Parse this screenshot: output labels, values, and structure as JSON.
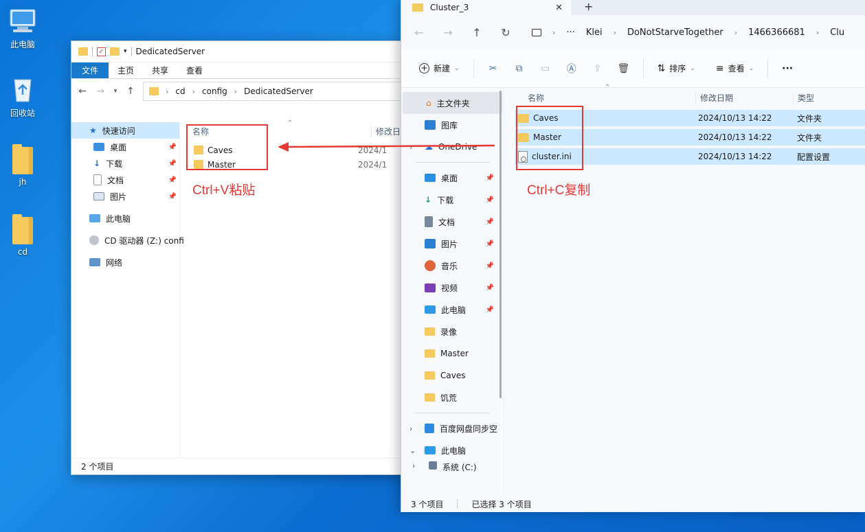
{
  "desktop": {
    "icons": [
      {
        "label": "此电脑",
        "icon": "computer-icon"
      },
      {
        "label": "回收站",
        "icon": "recycle-bin-icon"
      },
      {
        "label": "jh",
        "icon": "folder-icon"
      },
      {
        "label": "cd",
        "icon": "folder-icon"
      }
    ]
  },
  "left_window": {
    "title": "DedicatedServer",
    "ribbon_tabs": [
      "文件",
      "主页",
      "共享",
      "查看"
    ],
    "breadcrumb": [
      "cd",
      "config",
      "DedicatedServer"
    ],
    "nav": [
      {
        "label": "快速访问",
        "pinned": false
      },
      {
        "label": "桌面",
        "pinned": true
      },
      {
        "label": "下载",
        "pinned": true
      },
      {
        "label": "文档",
        "pinned": true
      },
      {
        "label": "图片",
        "pinned": true
      },
      {
        "label": "此电脑",
        "pinned": false
      },
      {
        "label": "CD 驱动器 (Z:) confi",
        "pinned": false
      },
      {
        "label": "网络",
        "pinned": false
      }
    ],
    "columns": {
      "name": "名称",
      "modified": "修改日期"
    },
    "files": [
      {
        "name": "Caves",
        "date": "2024/1"
      },
      {
        "name": "Master",
        "date": "2024/1"
      }
    ],
    "status": "2 个项目"
  },
  "right_window": {
    "tab_title": "Cluster_3",
    "breadcrumb": [
      "Klei",
      "DoNotStarveTogether",
      "1466366681",
      "Clu"
    ],
    "commands": {
      "new": "新建",
      "sort": "排序",
      "view": "查看",
      "more": "···"
    },
    "nav": [
      {
        "label": "主文件夹",
        "pinned": false
      },
      {
        "label": "图库",
        "pinned": false
      },
      {
        "label": "OneDrive",
        "pinned": false
      },
      {
        "label": "桌面",
        "pinned": true
      },
      {
        "label": "下载",
        "pinned": true
      },
      {
        "label": "文档",
        "pinned": true
      },
      {
        "label": "图片",
        "pinned": true
      },
      {
        "label": "音乐",
        "pinned": true
      },
      {
        "label": "视频",
        "pinned": true
      },
      {
        "label": "此电脑",
        "pinned": true
      },
      {
        "label": "录像",
        "pinned": false
      },
      {
        "label": "Master",
        "pinned": false
      },
      {
        "label": "Caves",
        "pinned": false
      },
      {
        "label": "饥荒",
        "pinned": false
      },
      {
        "label": "百度网盘同步空",
        "pinned": false
      },
      {
        "label": "此电脑",
        "pinned": false
      },
      {
        "label": "系统 (C:)",
        "pinned": false
      }
    ],
    "columns": {
      "name": "名称",
      "modified": "修改日期",
      "type": "类型"
    },
    "files": [
      {
        "name": "Caves",
        "date": "2024/10/13 14:22",
        "type": "文件夹",
        "icon": "folder-icon"
      },
      {
        "name": "Master",
        "date": "2024/10/13 14:22",
        "type": "文件夹",
        "icon": "folder-icon"
      },
      {
        "name": "cluster.ini",
        "date": "2024/10/13 14:22",
        "type": "配置设置",
        "icon": "ini-file-icon"
      }
    ],
    "status_count": "3 个项目",
    "status_selected": "已选择 3 个项目"
  },
  "annotations": {
    "paste": "Ctrl+V粘贴",
    "copy": "Ctrl+C复制",
    "color": "#e53935"
  }
}
